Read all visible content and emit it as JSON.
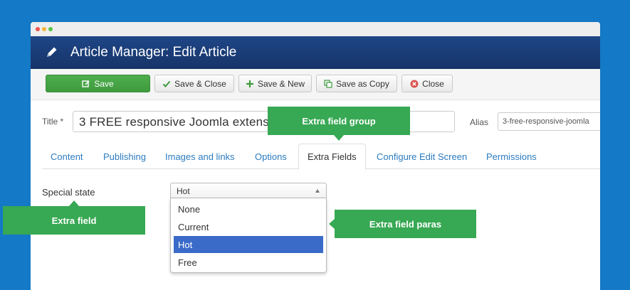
{
  "header": {
    "title": "Article Manager: Edit Article",
    "icon": "pencil-icon"
  },
  "toolbar": {
    "save": "Save",
    "save_close": "Save & Close",
    "save_new": "Save & New",
    "save_copy": "Save as Copy",
    "close": "Close"
  },
  "form": {
    "title_label": "Title *",
    "title_value": "3 FREE responsive Joomla extensions for Joomla 3",
    "alias_label": "Alias",
    "alias_value": "3-free-responsive-joomla"
  },
  "tabs": [
    "Content",
    "Publishing",
    "Images and links",
    "Options",
    "Extra Fields",
    "Configure Edit Screen",
    "Permissions"
  ],
  "active_tab": "Extra Fields",
  "extra": {
    "label": "Special state",
    "selected": "Hot",
    "options": [
      "None",
      "Current",
      "Hot",
      "Free"
    ]
  },
  "callouts": {
    "group": "Extra field group",
    "field": "Extra field",
    "paras": "Extra field paras"
  },
  "colors": {
    "background": "#1479c6",
    "header": "#1a3a72",
    "save": "#46a546",
    "callout": "#37a853",
    "selected_option": "#3a6bc9"
  }
}
